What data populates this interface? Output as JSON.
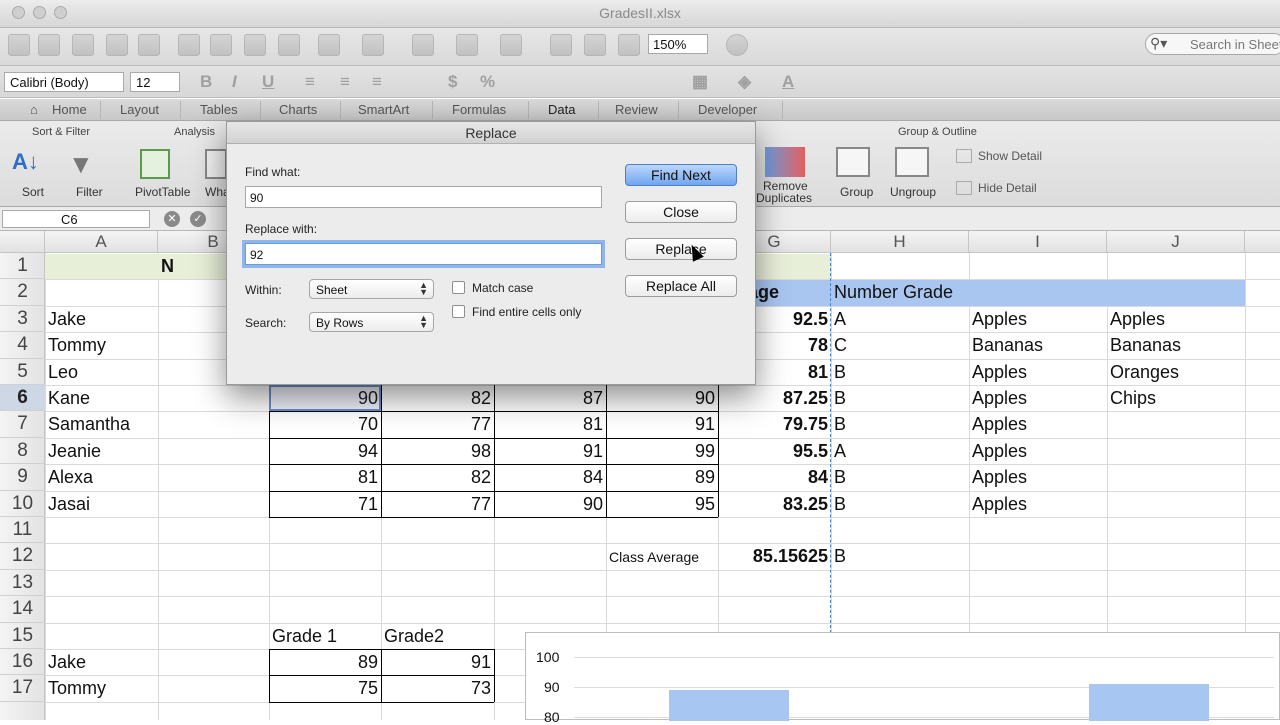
{
  "window": {
    "title": "GradesII.xlsx"
  },
  "toolbar": {
    "zoom": "150%",
    "search_placeholder": "Search in Sheet"
  },
  "format": {
    "font": "Calibri (Body)",
    "size": "12"
  },
  "ribbon_tabs": [
    "Home",
    "Layout",
    "Tables",
    "Charts",
    "SmartArt",
    "Formulas",
    "Data",
    "Review",
    "Developer"
  ],
  "ribbon": {
    "groups": {
      "sort_filter": "Sort & Filter",
      "analysis": "Analysis",
      "group_outline": "Group & Outline"
    },
    "buttons": {
      "sort": "Sort",
      "filter": "Filter",
      "pivot": "PivotTable",
      "whatif": "Wha",
      "remove_dup_1": "Remove",
      "remove_dup_2": "Duplicates",
      "group": "Group",
      "ungroup": "Ungroup",
      "show_detail": "Show Detail",
      "hide_detail": "Hide Detail"
    }
  },
  "namebox": "C6",
  "columns": [
    "A",
    "B",
    "",
    "",
    "",
    "",
    "G",
    "H",
    "I",
    "J"
  ],
  "rows": [
    "1",
    "2",
    "3",
    "4",
    "5",
    "6",
    "7",
    "8",
    "9",
    "10",
    "11",
    "12",
    "13",
    "14",
    "15",
    "16",
    "17"
  ],
  "cells": {
    "b1": "N",
    "g2": "verage",
    "h2": "Number Grade",
    "names": [
      "Jake",
      "Tommy",
      "Leo",
      "Kane",
      "Samantha",
      "Jeanie",
      "Alexa",
      "Jasai"
    ],
    "grades": [
      [
        "",
        "",
        "",
        "",
        "92.5",
        "A",
        "Apples",
        "Apples"
      ],
      [
        "",
        "",
        "",
        "",
        "78",
        "C",
        "Bananas",
        "Bananas"
      ],
      [
        "",
        "",
        "",
        "",
        "81",
        "B",
        "Apples",
        "Oranges"
      ],
      [
        "90",
        "82",
        "87",
        "90",
        "87.25",
        "B",
        "Apples",
        "Chips"
      ],
      [
        "70",
        "77",
        "81",
        "91",
        "79.75",
        "B",
        "Apples",
        ""
      ],
      [
        "94",
        "98",
        "91",
        "99",
        "95.5",
        "A",
        "Apples",
        ""
      ],
      [
        "81",
        "82",
        "84",
        "89",
        "84",
        "B",
        "Apples",
        ""
      ],
      [
        "71",
        "77",
        "90",
        "95",
        "83.25",
        "B",
        "Apples",
        ""
      ]
    ],
    "class_avg_label": "Class Average",
    "class_avg_value": "85.15625",
    "class_avg_grade": "B",
    "grade1_hdr": "Grade 1",
    "grade2_hdr": "Grade2",
    "r16": [
      "Jake",
      "89",
      "91"
    ],
    "r17": [
      "Tommy",
      "75",
      "73"
    ]
  },
  "dialog": {
    "title": "Replace",
    "find_label": "Find what:",
    "find_value": "90",
    "replace_label": "Replace with:",
    "replace_value": "92",
    "within_label": "Within:",
    "within_value": "Sheet",
    "search_label": "Search:",
    "search_value": "By Rows",
    "match_case": "Match case",
    "entire_cells": "Find entire cells only",
    "find_next": "Find Next",
    "close": "Close",
    "replace": "Replace",
    "replace_all": "Replace All"
  },
  "chart_data": {
    "type": "bar",
    "y_ticks": [
      "100",
      "90",
      "80"
    ],
    "ylim": [
      80,
      100
    ],
    "values_partial": [
      89,
      91
    ]
  },
  "colors": {
    "header_blue": "#a9c6f0",
    "row1_green": "#e8efd9",
    "default_btn": "#6fa6ef"
  }
}
